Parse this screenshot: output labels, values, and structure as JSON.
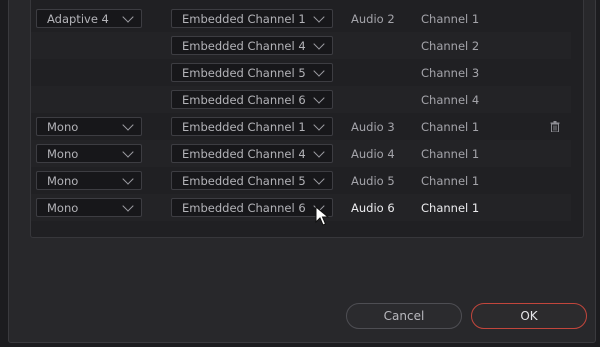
{
  "rows": [
    {
      "type": "Adaptive 4",
      "channel": "Embedded Channel 1",
      "audio": "Audio 2",
      "chan_label": "Channel 1"
    },
    {
      "type": "",
      "channel": "Embedded Channel 4",
      "audio": "",
      "chan_label": "Channel 2"
    },
    {
      "type": "",
      "channel": "Embedded Channel 5",
      "audio": "",
      "chan_label": "Channel 3"
    },
    {
      "type": "",
      "channel": "Embedded Channel 6",
      "audio": "",
      "chan_label": "Channel 4"
    },
    {
      "type": "Mono",
      "channel": "Embedded Channel 1",
      "audio": "Audio 3",
      "chan_label": "Channel 1"
    },
    {
      "type": "Mono",
      "channel": "Embedded Channel 4",
      "audio": "Audio 4",
      "chan_label": "Channel 1"
    },
    {
      "type": "Mono",
      "channel": "Embedded Channel 5",
      "audio": "Audio 5",
      "chan_label": "Channel 1"
    },
    {
      "type": "Mono",
      "channel": "Embedded Channel 6",
      "audio": "Audio 6",
      "chan_label": "Channel 1"
    }
  ],
  "buttons": {
    "cancel": "Cancel",
    "ok": "OK"
  },
  "icons": {
    "delete": "trash-icon",
    "cursor": "mouse-pointer-icon",
    "dropdown": "chevron-down-icon"
  },
  "colors": {
    "ok_border": "#c2463c",
    "background": "#28282b"
  }
}
